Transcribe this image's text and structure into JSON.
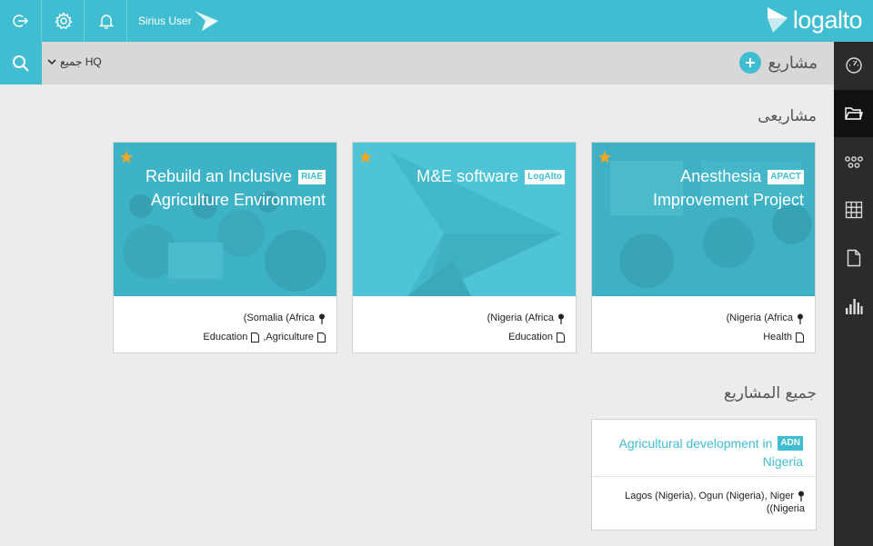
{
  "topbar": {
    "user_name": "Sirius User",
    "brand": "logalto"
  },
  "subbar": {
    "hq_label": "جميع HQ",
    "projects_label": "مشاريع"
  },
  "sections": {
    "my_projects": "مشاريعى",
    "all_projects": "جميع المشاريع"
  },
  "cards": [
    {
      "title_line1": "Rebuild an Inclusive",
      "title_line2": "Agriculture Environment",
      "badge": "RIAE",
      "location": "(Somalia (Africa",
      "tags": "Education ,Agriculture",
      "tag1": "Education",
      "tag2": ",Agriculture",
      "starred": true
    },
    {
      "title_line1": "M&E software",
      "title_line2": "",
      "badge": "LogAlto",
      "location": "(Nigeria (Africa",
      "tag1": "Education",
      "starred": true
    },
    {
      "title_line1": "Anesthesia",
      "title_line2": "Improvement Project",
      "badge": "APACT",
      "location": "(Nigeria (Africa",
      "tag1": "Health",
      "starred": true
    }
  ],
  "all_projects": [
    {
      "title_line1": "Agricultural development in",
      "title_line2": "Nigeria",
      "badge": "ADN",
      "location_line1": "Lagos (Nigeria), Ogun (Nigeria), Niger",
      "location_line2": "((Nigeria"
    }
  ],
  "colors": {
    "accent": "#41bdd1",
    "sidebar": "#2b2b2b",
    "star": "#f5a623"
  },
  "icons": {
    "logout": "logout-icon",
    "settings": "gear-icon",
    "notifications": "bell-icon",
    "search": "search-icon",
    "dashboard": "gauge-icon",
    "projects": "folder-icon",
    "network": "network-icon",
    "grid": "grid-icon",
    "document": "document-icon",
    "analytics": "bar-chart-icon"
  }
}
